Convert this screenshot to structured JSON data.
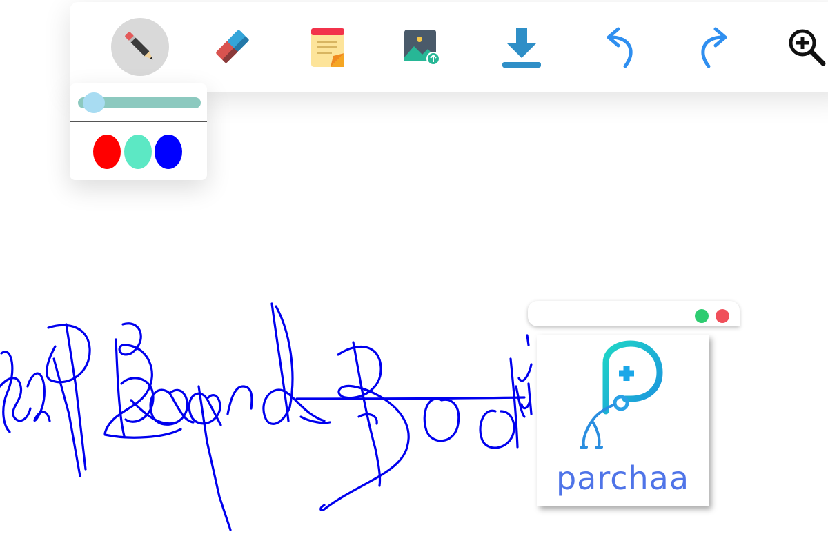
{
  "toolbar": {
    "tools": [
      {
        "name": "pencil",
        "icon": "pencil-icon",
        "active": true
      },
      {
        "name": "eraser",
        "icon": "eraser-icon",
        "active": false
      },
      {
        "name": "sticky-note",
        "icon": "sticky-note-icon",
        "active": false
      },
      {
        "name": "image-upload",
        "icon": "image-upload-icon",
        "active": false
      },
      {
        "name": "download",
        "icon": "download-icon",
        "active": false
      },
      {
        "name": "undo",
        "icon": "undo-icon",
        "active": false
      },
      {
        "name": "redo",
        "icon": "redo-icon",
        "active": false
      },
      {
        "name": "zoom-in",
        "icon": "zoom-in-icon",
        "active": false
      }
    ]
  },
  "pen_panel": {
    "stroke_size_level": 0.05,
    "colors": [
      "#ff0000",
      "#5ce8c4",
      "#0000ff"
    ]
  },
  "drawing": {
    "stroke_color": "#0000ee"
  },
  "logo_window": {
    "brand_text": "parchaa",
    "brand_color": "#4f74e8",
    "icon": "medical-stethoscope-logo-icon",
    "close_dot_color": "#f04f5a",
    "maximize_dot_color": "#2ecc71"
  }
}
